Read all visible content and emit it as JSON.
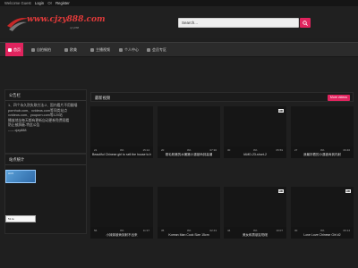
{
  "topbar": {
    "welcome": "Welcome Guest",
    "login": "Login",
    "or": "Or",
    "register": "Register"
  },
  "logo": {
    "url": "www.cjzy888.com",
    "sub": "cjzy888"
  },
  "search": {
    "placeholder": "Search..."
  },
  "nav": {
    "items": [
      {
        "label": "首页",
        "active": true
      },
      {
        "label": "自拍偷拍"
      },
      {
        "label": "欧美"
      },
      {
        "label": "主播视频"
      },
      {
        "label": "个人中心"
      },
      {
        "label": "会员专区"
      }
    ]
  },
  "notice": {
    "title": "公告栏",
    "lines": [
      "1、四个永久防失联方法:2、国内看片不用翻墙",
      "pornhub.com、xvideos.com等同类站点",
      "xvideos.com、youporn.com等120站",
      "播放地址每天都有更新自动更新免费观看",
      "防止被屏蔽-特此公告",
      "------cjzy888"
    ]
  },
  "stats": {
    "title": "站点统计",
    "ad1": "cnzz",
    "ad2": "51.la"
  },
  "videos": {
    "title": "最新视频",
    "more": "More videos",
    "items": [
      {
        "title": "",
        "views": "",
        "likes": "",
        "duration": "",
        "hd": false
      },
      {
        "title": "Beautiful Chinese girl to sell the house to her customer big chicken",
        "views": "21",
        "likes": "0%",
        "duration": "15:14",
        "hd": false
      },
      {
        "title": "刚毛粉嫩的水嫩嫩小逼被肏到高潮",
        "views": "20",
        "likes": "0%",
        "duration": "07:30",
        "hd": false
      },
      {
        "title": "IAMD-23-short-2",
        "views": "30",
        "likes": "0%",
        "duration": "05:59",
        "hd": true
      },
      {
        "title": "我最好看的小逼被肏到内射",
        "views": "27",
        "likes": "0%",
        "duration": "06:46",
        "hd": false
      },
      {
        "title": "",
        "views": "",
        "likes": "",
        "duration": "",
        "hd": false
      },
      {
        "title": "小妹妹被肏到射不出来",
        "views": "56",
        "likes": "0%",
        "duration": "11:37",
        "hd": false
      },
      {
        "title": "Korean Man Cock Size 15cm",
        "views": "35",
        "likes": "0%",
        "duration": "02:43",
        "hd": false
      },
      {
        "title": "美女和男朋友啪啪",
        "views": "44",
        "likes": "0%",
        "duration": "10:07",
        "hd": true
      },
      {
        "title": "Love Love Chinese Girl #2",
        "views": "30",
        "likes": "0%",
        "duration": "06:14",
        "hd": true
      }
    ]
  },
  "colors": {
    "accent": "#e0245e",
    "bg": "#1f1f1f"
  }
}
